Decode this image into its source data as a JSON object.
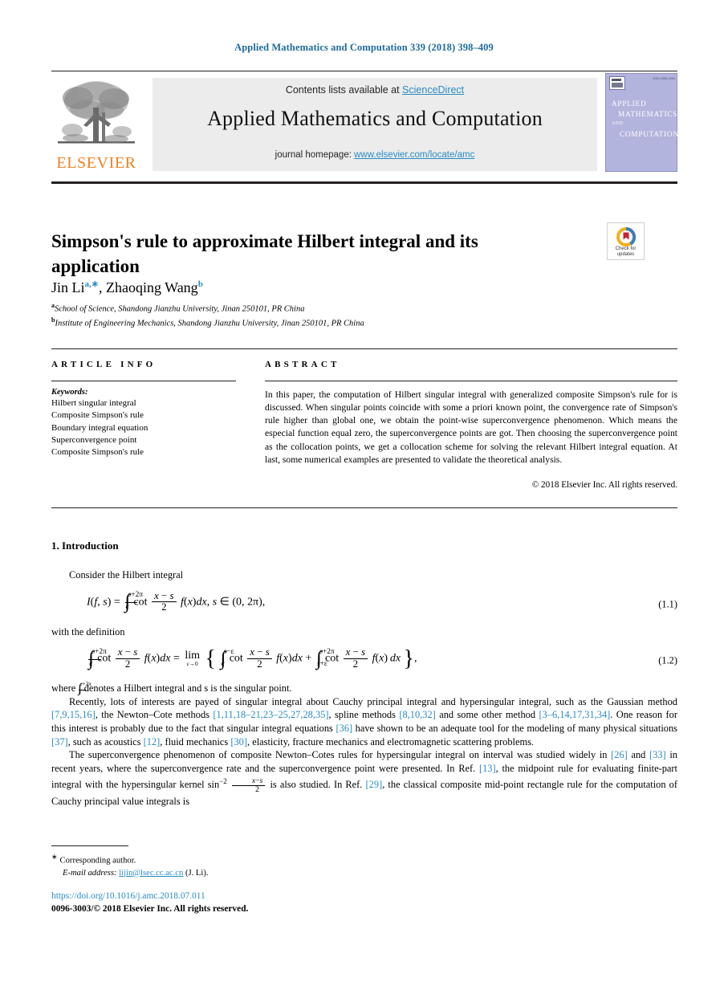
{
  "running_head": "Applied Mathematics and Computation 339 (2018) 398–409",
  "banner": {
    "publisher_name": "ELSEVIER",
    "contents_prefix": "Contents lists available at ",
    "contents_link": "ScienceDirect",
    "journal_title": "Applied Mathematics and Computation",
    "homepage_prefix": "journal homepage: ",
    "homepage_link": "www.elsevier.com/locate/amc",
    "cover": {
      "issn_text": "ISSN 0096-3003",
      "line1": "APPLIED",
      "line2": "MATHEMATICS",
      "line3": "AND",
      "line4": "COMPUTATION"
    }
  },
  "article": {
    "title": "Simpson's rule to approximate Hilbert integral and its application",
    "crossmark": {
      "line1": "Check for",
      "line2": "updates"
    },
    "authors": [
      {
        "name": "Jin Li",
        "marks": "a,∗"
      },
      {
        "name": "Zhaoqing Wang",
        "marks": "b"
      }
    ],
    "authors_separator": ", ",
    "affiliations": [
      {
        "mark": "a",
        "text": "School of Science, Shandong Jianzhu University, Jinan 250101, PR China"
      },
      {
        "mark": "b",
        "text": "Institute of Engineering Mechanics, Shandong Jianzhu University, Jinan 250101, PR China"
      }
    ]
  },
  "info": {
    "heading": "ARTICLE INFO",
    "keywords_label": "Keywords:",
    "keywords": [
      "Hilbert singular integral",
      "Composite Simpson's rule",
      "Boundary integral equation",
      "Superconvergence point",
      "Composite Simpson's rule"
    ]
  },
  "abstract": {
    "heading": "ABSTRACT",
    "body": "In this paper, the computation of Hilbert singular integral with generalized composite Simpson's rule for is discussed. When singular points coincide with some a priori known point, the convergence rate of Simpson's rule higher than global one, we obtain the point-wise superconvergence phenomenon. Which means the especial function equal zero, the superconvergence points are got. Then choosing the superconvergence point as the collocation points, we get a collocation scheme for solving the relevant Hilbert integral equation. At last, some numerical examples are presented to validate the theoretical analysis.",
    "copyright": "© 2018 Elsevier Inc. All rights reserved."
  },
  "body": {
    "section_number": "1.",
    "section_title": "Introduction",
    "lead_in": "Consider the Hilbert integral",
    "eq1_number": "(1.1)",
    "eq2_number": "(1.2)",
    "with_definition": "with the definition",
    "para_where_prefix": "where ",
    "para_where_suffix": " denotes a Hilbert integral and s is the singular point.",
    "para2": {
      "t1": "Recently, lots of interests are payed of singular integral about Cauchy principal integral and hypersingular integral, such as the Gaussian method ",
      "c1": "[7,9,15,16]",
      "t2": ", the Newton–Cote methods ",
      "c2": "[1,11,18–21,23–25,27,28,35]",
      "t3": ", spline methods ",
      "c3": "[8,10,32]",
      "t4": " and some other method ",
      "c4": "[3–6,14,17,31,34]",
      "t5": ". One reason for this interest is probably due to the fact that singular integral equations ",
      "c5": "[36]",
      "t6": " have shown to be an adequate tool for the modeling of many physical situations ",
      "c6": "[37]",
      "t7": ", such as acoustics ",
      "c7": "[12]",
      "t8": ", fluid mechanics ",
      "c8": "[30]",
      "t9": ", elasticity, fracture mechanics and electromagnetic scattering problems."
    },
    "para3": {
      "t1": "The superconvergence phenomenon of composite Newton–Cotes rules for hypersingular integral on interval was studied widely in ",
      "c1": "[26]",
      "t2": " and ",
      "c2": "[33]",
      "t3": " in recent years, where the superconvergence rate and the superconvergence point were presented. In Ref. ",
      "c3": "[13]",
      "t4": ", the midpoint rule for evaluating finite-part integral with the hypersingular kernel sin",
      "t5": " is also studied. In Ref. ",
      "c4": "[29]",
      "t6": ", the classical composite mid-point rectangle rule for the computation of Cauchy principal value integrals is"
    }
  },
  "footnotes": {
    "corresponding": "Corresponding author.",
    "email_label": "E-mail address:",
    "email": "lijin@lsec.cc.ac.cn",
    "email_owner": "(J. Li).",
    "doi": "https://doi.org/10.1016/j.amc.2018.07.011",
    "issn_copyright": "0096-3003/© 2018 Elsevier Inc. All rights reserved."
  },
  "colors": {
    "link_blue": "#2b8bc4",
    "header_blue": "#1f6b9c",
    "elsevier_orange": "#f08122",
    "banner_gray": "#ececec",
    "cover_purple": "#b3b4dd"
  }
}
